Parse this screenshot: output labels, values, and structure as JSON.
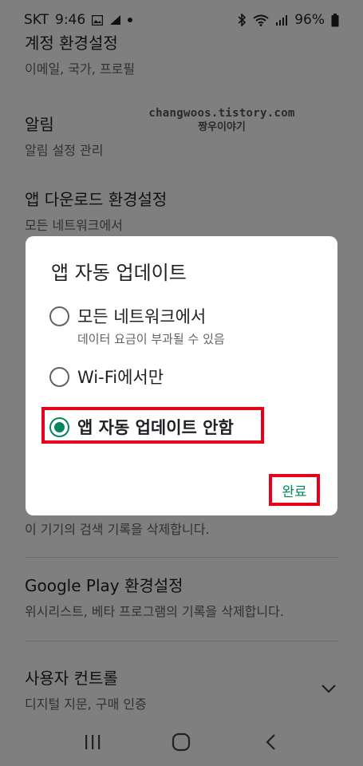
{
  "status_bar": {
    "carrier": "SKT",
    "time": "9:46",
    "battery": "96%",
    "icons": [
      "gallery-icon",
      "sync-icon",
      "dot-icon",
      "bluetooth-icon",
      "wifi-icon",
      "signal-icon",
      "battery-icon"
    ]
  },
  "settings": {
    "items": [
      {
        "title": "계정 환경설정",
        "subtitle": "이메일, 국가, 프로필"
      },
      {
        "title": "알림",
        "subtitle": "알림 설정 관리"
      },
      {
        "title": "앱 다운로드 환경설정",
        "subtitle": "모든 네트워크에서"
      },
      {
        "title": "",
        "subtitle": "이 기기의 검색 기록을 삭제합니다."
      },
      {
        "title": "Google Play 환경설정",
        "subtitle": "위시리스트, 베타 프로그램의 기록을 삭제합니다."
      },
      {
        "title": "사용자 컨트롤",
        "subtitle": "디지털 지문, 구매 인증"
      }
    ]
  },
  "watermark": {
    "url": "changwoos.tistory.com",
    "name": "짱우이야기"
  },
  "dialog": {
    "title": "앱 자동 업데이트",
    "options": [
      {
        "label": "모든 네트워크에서",
        "sublabel": "데이터 요금이 부과될 수 있음",
        "checked": false
      },
      {
        "label": "Wi-Fi에서만",
        "sublabel": "",
        "checked": false
      },
      {
        "label": "앱 자동 업데이트 안함",
        "sublabel": "",
        "checked": true
      }
    ],
    "done_label": "완료"
  },
  "colors": {
    "accent": "#01875f",
    "highlight": "#e8001a",
    "scrim": "#000000"
  }
}
